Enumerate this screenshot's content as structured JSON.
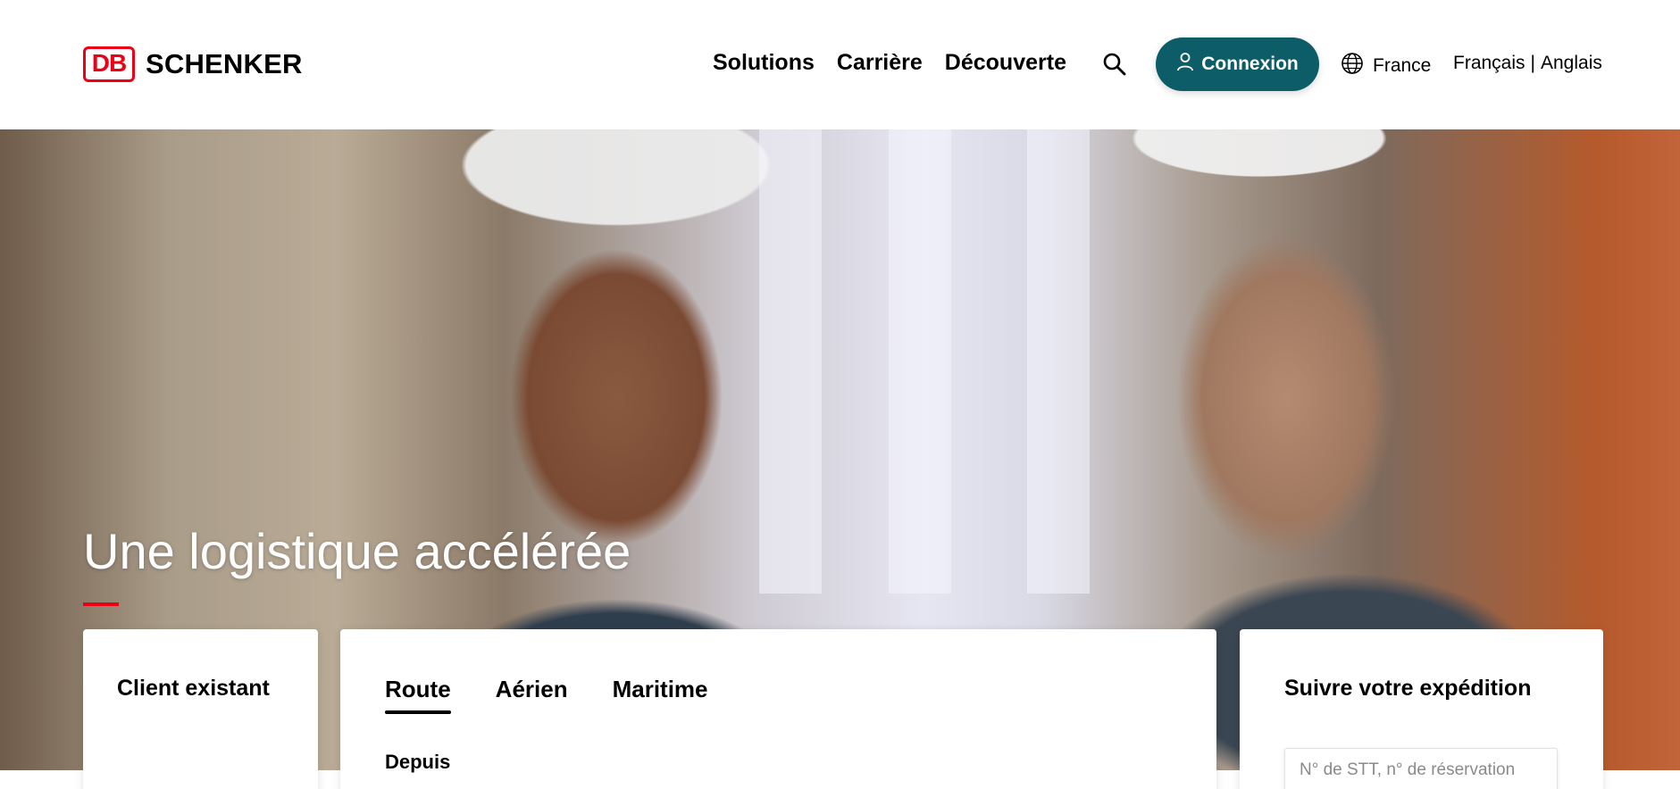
{
  "header": {
    "logo_mark": "DB",
    "brand": "SCHENKER",
    "nav": [
      "Solutions",
      "Carrière",
      "Découverte"
    ],
    "login_label": "Connexion",
    "country": "France",
    "languages": {
      "first": "Français",
      "separator": "|",
      "second": "Anglais"
    }
  },
  "hero": {
    "title": "Une logistique accélérée"
  },
  "client_card": {
    "title": "Client existant"
  },
  "quote_card": {
    "tabs": [
      "Route",
      "Aérien",
      "Maritime"
    ],
    "active_tab": "Route",
    "from_label": "Depuis"
  },
  "track_card": {
    "title": "Suivre votre expédition",
    "placeholder": "N° de STT, n° de réservation"
  },
  "colors": {
    "brand_red": "#ec0016",
    "login_bg": "#0c5d67"
  },
  "icons": [
    "search-icon",
    "user-icon",
    "globe-icon"
  ]
}
